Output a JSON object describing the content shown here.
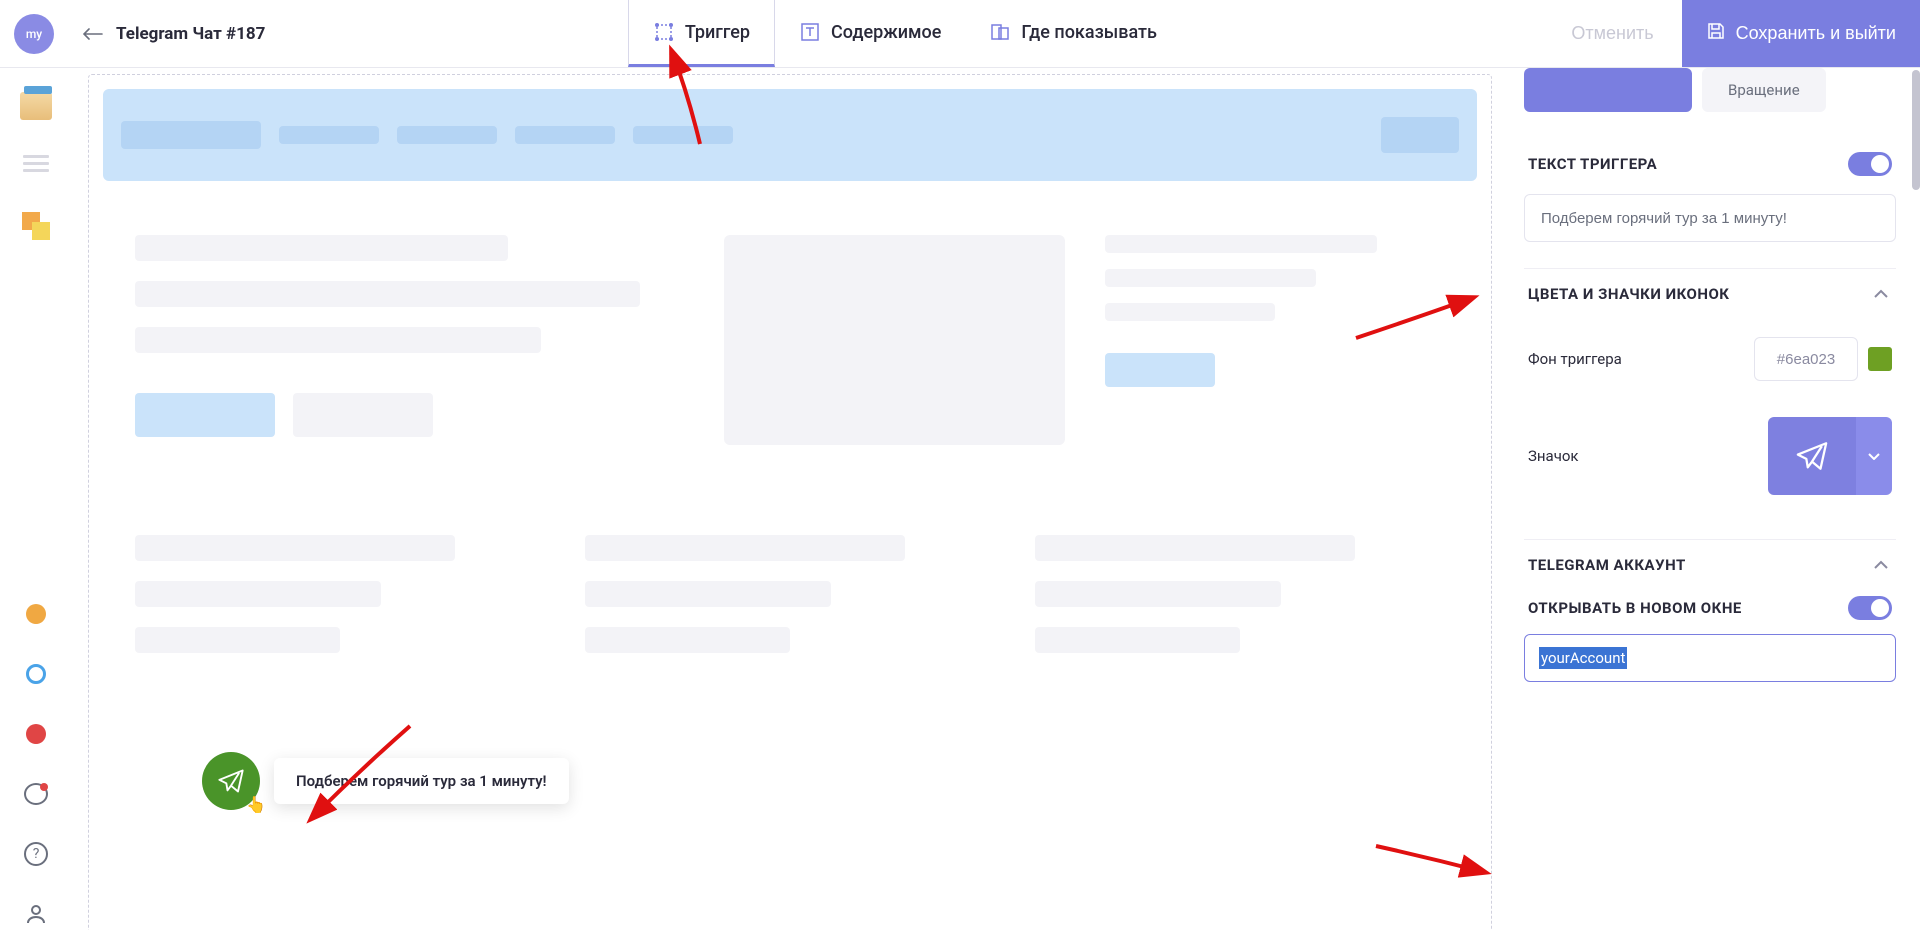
{
  "header": {
    "avatar_text": "my",
    "title": "Telegram Чат #187",
    "tabs": {
      "trigger": "Триггер",
      "content": "Содержимое",
      "where": "Где показывать"
    },
    "cancel": "Отменить",
    "save": "Сохранить и выйти"
  },
  "widget": {
    "text": "Подберем горячий тур за 1 минуту!"
  },
  "panel": {
    "chip_rotation": "Вращение",
    "text_trigger_title": "ТЕКСТ ТРИГГЕРА",
    "text_trigger_value": "Подберем горячий тур за 1 минуту!",
    "colors_title": "ЦВЕТА И ЗНАЧКИ ИКОНОК",
    "bg_label": "Фон триггера",
    "bg_hex": "#6ea023",
    "icon_label": "Значок",
    "telegram_title": "TELEGRAM АККАУНТ",
    "new_window_title": "ОТКРЫВАТЬ В НОВОМ ОКНЕ",
    "account_value": "yourAccount"
  }
}
